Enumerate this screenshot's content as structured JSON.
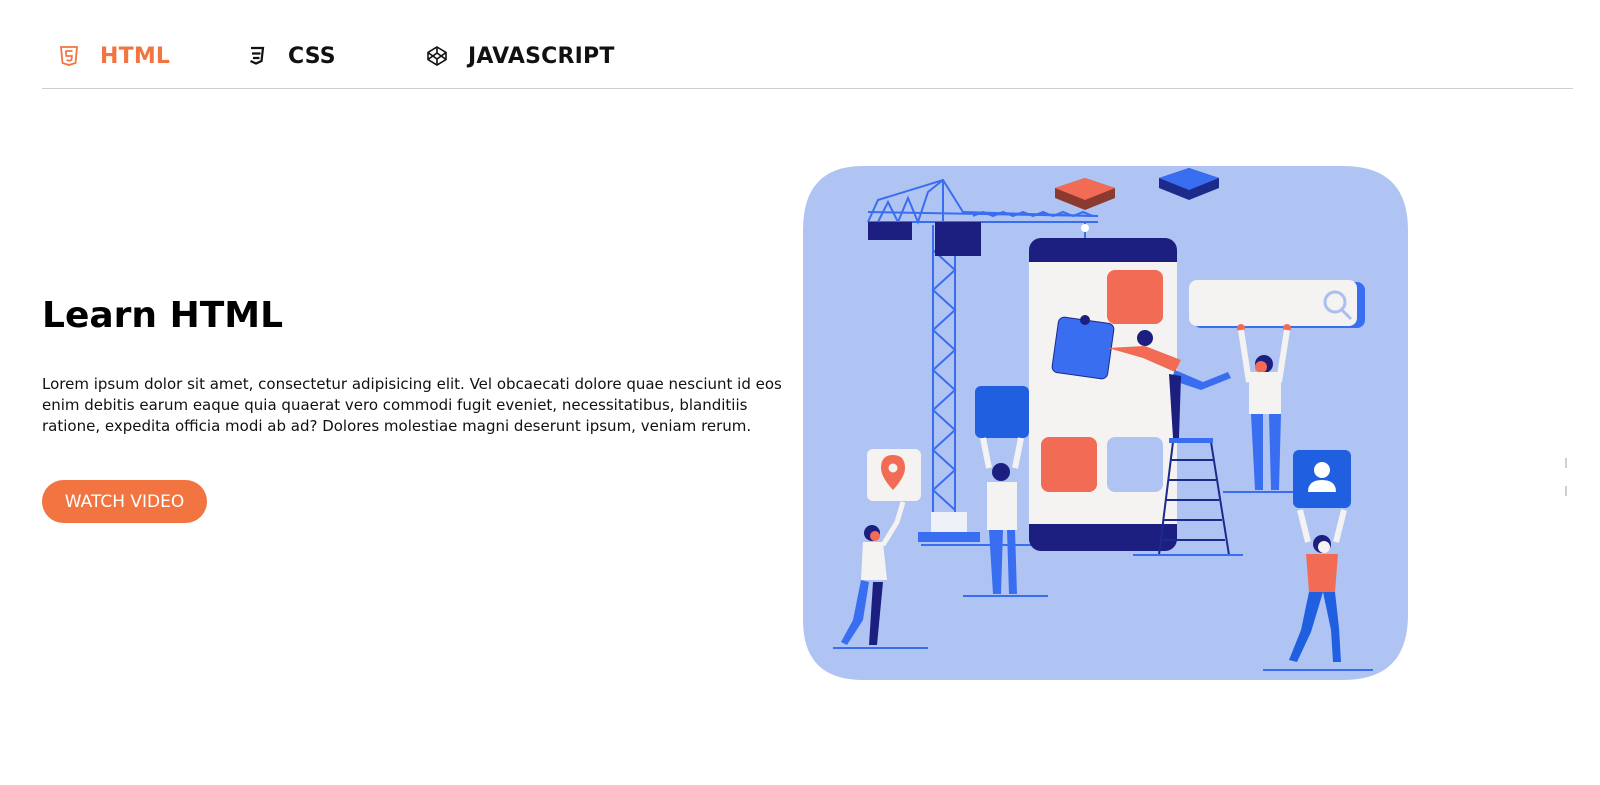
{
  "tabs": [
    {
      "label": "HTML",
      "icon": "html5-icon",
      "active": true
    },
    {
      "label": "CSS",
      "icon": "css3-icon",
      "active": false
    },
    {
      "label": "JAVASCRIPT",
      "icon": "codepen-icon",
      "active": false
    }
  ],
  "content": {
    "title": "Learn HTML",
    "description": "Lorem ipsum dolor sit amet, consectetur adipisicing elit. Vel obcaecati dolore quae nesciunt id eos enim debitis earum eaque quia quaerat vero commodi fugit eveniet, necessitatibus, blanditiis ratione, expedita officia modi ab ad? Dolores molestiae magni deserunt ipsum, veniam rerum.",
    "button_label": "WATCH VIDEO"
  },
  "colors": {
    "accent": "#f27441",
    "illustration_bg": "#b0c4f4",
    "navy": "#1c1e80",
    "blue": "#3a77f0",
    "coral": "#f26b55"
  }
}
